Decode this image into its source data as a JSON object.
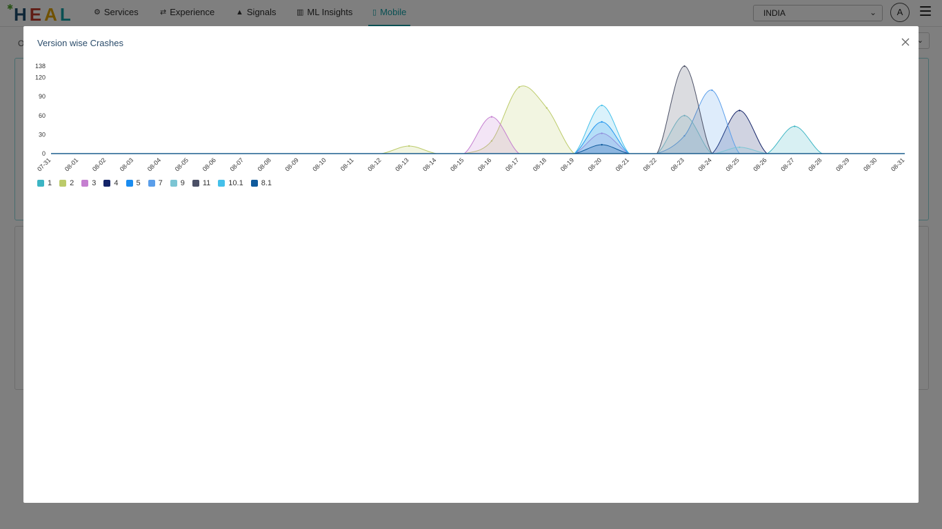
{
  "app": {
    "logo_text": "HEAL",
    "logo_letters": [
      {
        "ch": "H",
        "color": "#1c4d6e"
      },
      {
        "ch": "E",
        "color": "#c0392b"
      },
      {
        "ch": "A",
        "color": "#e0a300"
      },
      {
        "ch": "L",
        "color": "#13a0a6"
      }
    ]
  },
  "nav": {
    "items": [
      {
        "label": "Services",
        "icon": "gears-icon"
      },
      {
        "label": "Experience",
        "icon": "shuffle-icon"
      },
      {
        "label": "Signals",
        "icon": "warning-icon"
      },
      {
        "label": "ML Insights",
        "icon": "bar-chart-icon"
      },
      {
        "label": "Mobile",
        "icon": "mobile-icon",
        "active": true
      }
    ],
    "accent_color": "#13a0a6"
  },
  "header": {
    "country_selected": "INDIA",
    "avatar_initial": "A"
  },
  "background": {
    "label_fragment": "O"
  },
  "modal": {
    "title": "Version wise Crashes"
  },
  "chart_data": {
    "type": "area",
    "title": "",
    "xlabel": "",
    "ylabel": "",
    "ylim": [
      0,
      138
    ],
    "yticks": [
      0,
      30,
      60,
      90,
      120,
      138
    ],
    "x": [
      "07-31",
      "08-01",
      "08-02",
      "08-03",
      "08-04",
      "08-05",
      "08-06",
      "08-07",
      "08-08",
      "08-09",
      "08-10",
      "08-11",
      "08-12",
      "08-13",
      "08-14",
      "08-15",
      "08-16",
      "08-17",
      "08-18",
      "08-19",
      "08-20",
      "08-21",
      "08-22",
      "08-23",
      "08-24",
      "08-25",
      "08-26",
      "08-27",
      "08-28",
      "08-29",
      "08-30",
      "08-31"
    ],
    "grid": false,
    "legend_placement": "bottom-left",
    "series": [
      {
        "name": "1",
        "color": "#3cb5c4",
        "values": [
          0,
          0,
          0,
          0,
          0,
          0,
          0,
          0,
          0,
          0,
          0,
          0,
          0,
          0,
          0,
          0,
          0,
          0,
          0,
          0,
          0,
          0,
          0,
          0,
          0,
          0,
          0,
          43,
          0,
          0,
          0,
          0
        ]
      },
      {
        "name": "2",
        "color": "#bccb6a",
        "values": [
          0,
          0,
          0,
          0,
          0,
          0,
          0,
          0,
          0,
          0,
          0,
          0,
          0,
          12,
          0,
          0,
          20,
          105,
          72,
          0,
          0,
          0,
          0,
          0,
          0,
          0,
          0,
          0,
          0,
          0,
          0,
          0
        ]
      },
      {
        "name": "3",
        "color": "#c57fd0",
        "values": [
          0,
          0,
          0,
          0,
          0,
          0,
          0,
          0,
          0,
          0,
          0,
          0,
          0,
          0,
          0,
          0,
          58,
          0,
          0,
          0,
          32,
          0,
          0,
          0,
          0,
          0,
          0,
          0,
          0,
          0,
          0,
          0
        ]
      },
      {
        "name": "4",
        "color": "#142468",
        "values": [
          0,
          0,
          0,
          0,
          0,
          0,
          0,
          0,
          0,
          0,
          0,
          0,
          0,
          0,
          0,
          0,
          0,
          0,
          0,
          0,
          0,
          0,
          0,
          0,
          0,
          68,
          0,
          0,
          0,
          0,
          0,
          0
        ]
      },
      {
        "name": "5",
        "color": "#1a8cf0",
        "values": [
          0,
          0,
          0,
          0,
          0,
          0,
          0,
          0,
          0,
          0,
          0,
          0,
          0,
          0,
          0,
          0,
          0,
          0,
          0,
          0,
          50,
          0,
          0,
          0,
          0,
          0,
          0,
          0,
          0,
          0,
          0,
          0
        ]
      },
      {
        "name": "7",
        "color": "#5b9eea",
        "values": [
          0,
          0,
          0,
          0,
          0,
          0,
          0,
          0,
          0,
          0,
          0,
          0,
          0,
          0,
          0,
          0,
          0,
          0,
          0,
          0,
          0,
          0,
          0,
          28,
          100,
          0,
          0,
          0,
          0,
          0,
          0,
          0
        ]
      },
      {
        "name": "9",
        "color": "#7cc5d4",
        "values": [
          0,
          0,
          0,
          0,
          0,
          0,
          0,
          0,
          0,
          0,
          0,
          0,
          0,
          0,
          0,
          0,
          0,
          0,
          0,
          0,
          0,
          0,
          0,
          60,
          0,
          10,
          0,
          0,
          0,
          0,
          0,
          0
        ]
      },
      {
        "name": "11",
        "color": "#4b5066",
        "values": [
          0,
          0,
          0,
          0,
          0,
          0,
          0,
          0,
          0,
          0,
          0,
          0,
          0,
          0,
          0,
          0,
          0,
          0,
          0,
          0,
          0,
          0,
          0,
          138,
          0,
          0,
          0,
          0,
          0,
          0,
          0,
          0
        ]
      },
      {
        "name": "10.1",
        "color": "#45c0ea",
        "values": [
          0,
          0,
          0,
          0,
          0,
          0,
          0,
          0,
          0,
          0,
          0,
          0,
          0,
          0,
          0,
          0,
          0,
          0,
          0,
          0,
          76,
          0,
          0,
          0,
          0,
          0,
          0,
          0,
          0,
          0,
          0,
          0
        ]
      },
      {
        "name": "8.1",
        "color": "#0f5a9c",
        "values": [
          0,
          0,
          0,
          0,
          0,
          0,
          0,
          0,
          0,
          0,
          0,
          0,
          0,
          0,
          0,
          0,
          0,
          0,
          0,
          0,
          14,
          0,
          0,
          0,
          0,
          0,
          0,
          0,
          0,
          0,
          0,
          0
        ]
      }
    ]
  }
}
